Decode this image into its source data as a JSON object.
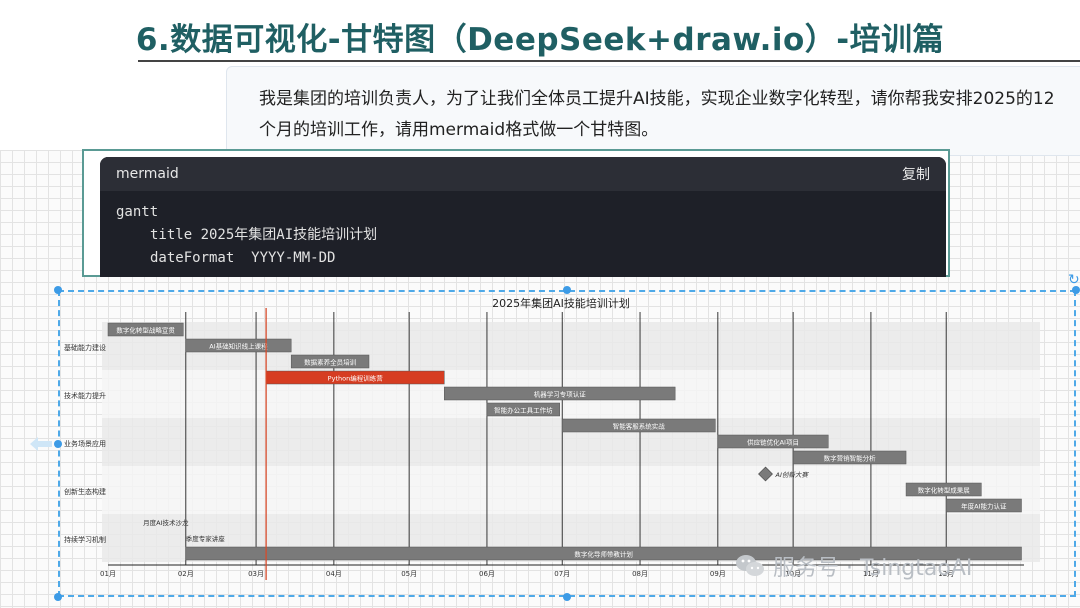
{
  "slide": {
    "title": "6.数据可视化-甘特图（DeepSeek+draw.io）-培训篇"
  },
  "prompt": {
    "text": "我是集团的培训负责人，为了让我们全体员工提升AI技能，实现企业数字化转型，请你帮我安排2025的12个月的培训工作，请用mermaid格式做一个甘特图。"
  },
  "code_block": {
    "language": "mermaid",
    "copy_label": "复制",
    "lines": [
      "gantt",
      "title 2025年集团AI技能培训计划",
      "dateFormat  YYYY-MM-DD"
    ]
  },
  "colors": {
    "task": "#7a7a7a",
    "critical": "#d63d22",
    "today": "#d64a2a",
    "selection": "#3d9be6",
    "title": "#1f5f63"
  },
  "chart_data": {
    "type": "gantt",
    "title": "2025年集团AI技能培训计划",
    "months": [
      "01月",
      "02月",
      "03月",
      "04月",
      "05月",
      "06月",
      "07月",
      "08月",
      "09月",
      "10月",
      "11月",
      "12月"
    ],
    "today_marker": "2025-03-05",
    "sections": [
      {
        "name": "基础能力建设",
        "tasks": [
          {
            "name": "数字化转型战略宣贯",
            "start": "2025-01-01",
            "end": "2025-01-31",
            "status": "done"
          },
          {
            "name": "AI基础知识线上课程",
            "start": "2025-02-01",
            "end": "2025-03-15",
            "status": "done"
          },
          {
            "name": "数据素养全员培训",
            "start": "2025-03-15",
            "end": "2025-04-15",
            "status": "normal"
          }
        ]
      },
      {
        "name": "技术能力提升",
        "tasks": [
          {
            "name": "Python编程训练营",
            "start": "2025-03-05",
            "end": "2025-05-15",
            "status": "critical"
          },
          {
            "name": "机器学习专项认证",
            "start": "2025-05-15",
            "end": "2025-08-15",
            "status": "normal"
          },
          {
            "name": "智能办公工具工作坊",
            "start": "2025-06-01",
            "end": "2025-06-30",
            "status": "normal"
          }
        ]
      },
      {
        "name": "业务场景应用",
        "tasks": [
          {
            "name": "智能客服系统实战",
            "start": "2025-07-01",
            "end": "2025-08-31",
            "status": "normal"
          },
          {
            "name": "供应链优化AI项目",
            "start": "2025-09-01",
            "end": "2025-10-15",
            "status": "normal"
          },
          {
            "name": "数字营销智能分析",
            "start": "2025-10-01",
            "end": "2025-11-15",
            "status": "normal"
          }
        ]
      },
      {
        "name": "创新生态构建",
        "tasks": [
          {
            "name": "AI创新大赛",
            "start": "2025-09-20",
            "end": "2025-09-20",
            "status": "milestone"
          },
          {
            "name": "数字化转型成果展",
            "start": "2025-11-15",
            "end": "2025-12-15",
            "status": "normal"
          },
          {
            "name": "年度AI能力认证",
            "start": "2025-12-01",
            "end": "2025-12-31",
            "status": "normal"
          }
        ]
      },
      {
        "name": "持续学习机制",
        "tasks": [
          {
            "name": "月度AI技术沙龙",
            "start": "2025-01-15",
            "end": "2025-01-15",
            "status": "label"
          },
          {
            "name": "季度专家讲座",
            "start": "2025-02-01",
            "end": "2025-02-01",
            "status": "label"
          },
          {
            "name": "数字化导师带教计划",
            "start": "2025-02-01",
            "end": "2025-12-31",
            "status": "normal"
          }
        ]
      }
    ]
  },
  "watermark": {
    "text": "服务号 · TsingtaoAI"
  }
}
